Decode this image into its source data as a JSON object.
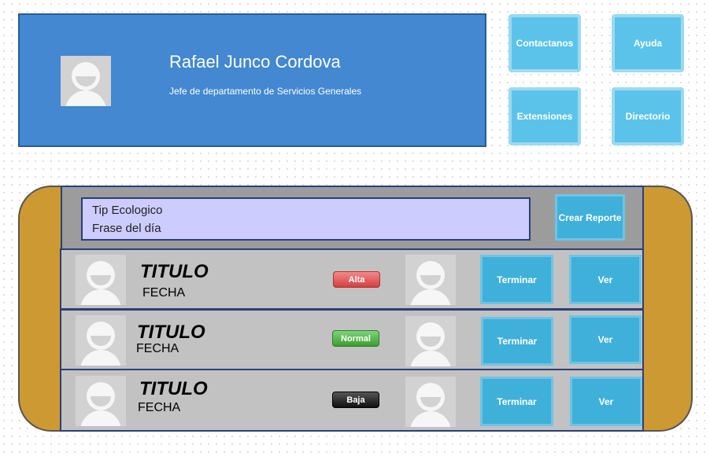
{
  "profile": {
    "name": "Rafael Junco Cordova",
    "role": "Jefe de departamento de Servicios Generales"
  },
  "tiles": {
    "contact": "Contactanos",
    "help": "Ayuda",
    "extensions": "Extensiones",
    "directory": "Directorio"
  },
  "tip": {
    "line1": "Tip Ecologico",
    "line2": "Frase del día"
  },
  "create_report": "Crear Reporte",
  "reports": [
    {
      "title": "TITULO",
      "date": "FECHA",
      "priority": "Alta",
      "finish": "Terminar",
      "view": "Ver"
    },
    {
      "title": "TITULO",
      "date": "FECHA",
      "priority": "Normal",
      "finish": "Terminar",
      "view": "Ver"
    },
    {
      "title": "TITULO",
      "date": "FECHA",
      "priority": "Baja",
      "finish": "Terminar",
      "view": "Ver"
    }
  ],
  "colors": {
    "profile_bg": "#4388d0",
    "tile_bg": "#5bc3ea",
    "panel_frame": "#cc9933",
    "tip_bg": "#ccccff",
    "priority_high": "#d43f3f",
    "priority_normal": "#3e9e2e",
    "priority_low": "#111111"
  }
}
